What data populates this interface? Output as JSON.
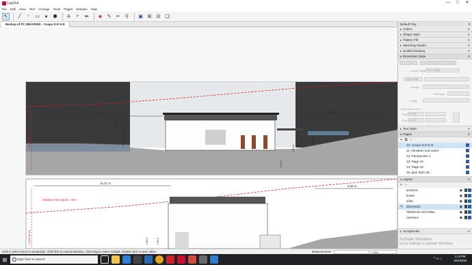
{
  "window": {
    "title": "LayOut",
    "controls": [
      "—",
      "□",
      "✕"
    ]
  },
  "menu": [
    "File",
    "Edit",
    "View",
    "Text",
    "Arrange",
    "Tools",
    "Pages",
    "Window",
    "Help"
  ],
  "toolbar": {
    "tools": [
      "select-icon",
      "line-icon",
      "arc-icon",
      "rectangle-icon",
      "circle-icon",
      "polygon-icon",
      "text-icon",
      "label-icon",
      "dimension-icon",
      "eraser-icon",
      "style-icon",
      "split-icon",
      "join-icon",
      "present-icon",
      "add-page-icon",
      "delete-page-icon",
      "scrapbook-icon"
    ]
  },
  "document": {
    "tab_label": "Backup of PC 3BASSINS - Coupe D-D E-E"
  },
  "drawing": {
    "top": {
      "dim_left": "15.77 m",
      "dim_right": "11.35 m",
      "dim_vertical": "7.15 m",
      "limit_label": "Limite Terrain",
      "small_dims": [
        "3.75 m",
        "1.82 m",
        "2.70 m"
      ]
    },
    "bottom": {
      "dim_left": "16.37 m",
      "dim_right": "5.45 m",
      "height_note": "Hauteur max egout = 8 m",
      "limit_label": "Limite Terrain",
      "small_dims": [
        "1.98 m",
        "1.98 m"
      ]
    }
  },
  "tray": {
    "title": "Default Tray",
    "sections": {
      "colors": "Colors",
      "shape_style": "Shape Style",
      "pattern_fill": "Pattern Fill",
      "sketchup_model": "SketchUp Model",
      "scaled_drawing": "Scaled Drawing",
      "dimension_style": "Dimension Style",
      "text_style": "Text Style",
      "pages": "Pages",
      "layers": "Layers",
      "scrapbooks": "Scrapbooks"
    },
    "dimension_style": {
      "leader_label": "Leader Style",
      "leader_value": "No Leader",
      "scale_label": "Auto Scale",
      "length_label": "Length",
      "precision_label": "Precision",
      "angle_label": "Angle",
      "dimension_lines_label": "Dimension Lines",
      "start_label": "Start",
      "start_value": "0.125\"",
      "end_label": "End",
      "end_value": "0.125\""
    },
    "pages": [
      {
        "label": "10: Coupe D-D E-E",
        "selected": true
      },
      {
        "label": "11: elevation sud ouest",
        "selected": false
      },
      {
        "label": "12: Perspective 1",
        "selected": false
      },
      {
        "label": "13: Page 15",
        "selected": false
      },
      {
        "label": "14: Page 16",
        "selected": false
      },
      {
        "label": "15: plan RDC 50",
        "selected": false
      }
    ],
    "layers": [
      {
        "label": "sections",
        "selected": false
      },
      {
        "label": "levels",
        "selected": false
      },
      {
        "label": "infos",
        "selected": false
      },
      {
        "label": "dimension",
        "selected": true
      },
      {
        "label": "TERRAIN NATUREL",
        "selected": false
      },
      {
        "label": "carreaux",
        "selected": false
      }
    ]
  },
  "watermark": {
    "line1": "Activate Windows",
    "line2": "Go to Settings to activate Windows."
  },
  "status": {
    "hint": "Click to select items to manipulate. Shift-click to extend selection. Click-drag to select multiple. Double-click to open editor.",
    "measurements_label": "Measurements",
    "zoom": "33%"
  },
  "taskbar": {
    "search_placeholder": "Type here to search",
    "time": "1:13 PM",
    "date": "9/24/2020"
  },
  "colors": {
    "accent": "#2b5fa0",
    "selection": "#cfe3f6",
    "dimension_red": "#d62020",
    "ground_gray": "#8a8a8a"
  }
}
